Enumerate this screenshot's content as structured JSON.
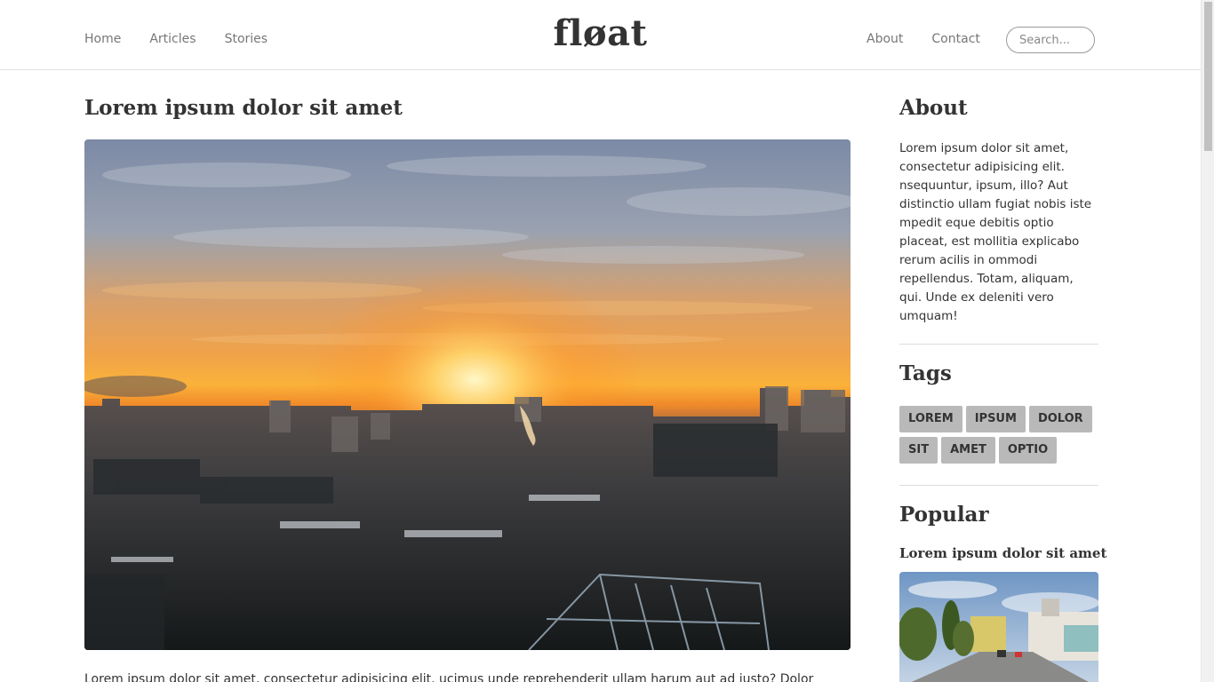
{
  "header": {
    "logo": "fløat",
    "nav_left": [
      "Home",
      "Articles",
      "Stories"
    ],
    "nav_right": [
      "About",
      "Contact"
    ],
    "search_placeholder": "Search..."
  },
  "main": {
    "title": "Lorem ipsum dolor sit amet",
    "excerpt": "Lorem ipsum dolor sit amet, consectetur adipisicing elit. ucimus unde reprehenderit ullam harum aut ad iusto? Dolor"
  },
  "sidebar": {
    "about_heading": "About",
    "about_text": "Lorem ipsum dolor sit amet, consectetur adipisicing elit. nsequuntur, ipsum, illo? Aut distinctio ullam fugiat nobis iste mpedit eque debitis optio placeat, est mollitia explicabo rerum acilis in ommodi repellendus. Totam, aliquam, qui. Unde ex deleniti vero umquam!",
    "tags_heading": "Tags",
    "tags": [
      "LOREM",
      "IPSUM",
      "DOLOR",
      "SIT",
      "AMET",
      "OPTIO"
    ],
    "popular_heading": "Popular",
    "popular_title": "Lorem ipsum dolor sit amet"
  }
}
